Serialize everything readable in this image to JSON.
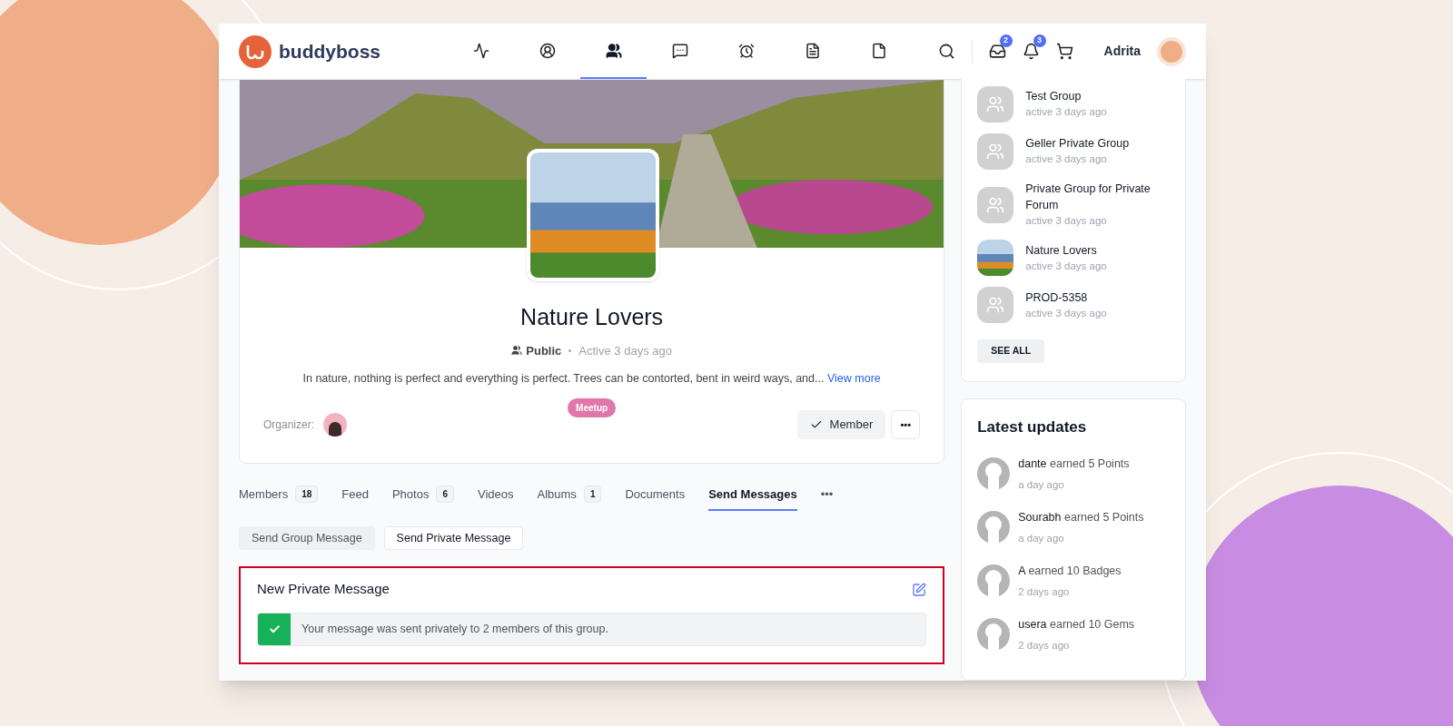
{
  "header": {
    "logo": "buddyboss",
    "nav": [
      {
        "selected": false
      },
      {
        "selected": false
      },
      {
        "selected": true
      },
      {
        "selected": false
      },
      {
        "selected": false
      },
      {
        "selected": false
      },
      {
        "selected": false
      }
    ],
    "inbox_count": "2",
    "notification_count": "3",
    "user": "Adrita"
  },
  "group": {
    "name": "Nature Lovers",
    "privacy": "Public",
    "activity": "Active 3 days ago",
    "description": "In nature, nothing is perfect and everything is perfect. Trees can be contorted, bent in weird ways, and...",
    "more_link": "View more",
    "tag": "Meetup",
    "organizer_label": "Organizer:",
    "member_button": "Member",
    "more_button": "•••"
  },
  "tabs": [
    {
      "label": "Members",
      "count": "18",
      "selected": false
    },
    {
      "label": "Feed",
      "selected": false
    },
    {
      "label": "Photos",
      "count": "6",
      "selected": false
    },
    {
      "label": "Videos",
      "selected": false
    },
    {
      "label": "Albums",
      "count": "1",
      "selected": false
    },
    {
      "label": "Documents",
      "selected": false
    },
    {
      "label": "Send Messages",
      "selected": true
    },
    {
      "label": "•••",
      "selected": false
    }
  ],
  "subtabs": [
    {
      "label": "Send Group Message",
      "selected": false
    },
    {
      "label": "Send Private Message",
      "selected": true
    }
  ],
  "message_panel": {
    "title": "New Private Message",
    "notice": "Your message was sent privately to 2 members of this group."
  },
  "groups_widget": {
    "items": [
      {
        "name": "Test Group",
        "time": "active 3 days ago",
        "kind": "default"
      },
      {
        "name": "Geller Private Group",
        "time": "active 3 days ago",
        "kind": "default"
      },
      {
        "name": "Private Group for Private Forum",
        "time": "active 3 days ago",
        "kind": "default"
      },
      {
        "name": "Nature Lovers",
        "time": "active 3 days ago",
        "kind": "photo"
      },
      {
        "name": "PROD-5358",
        "time": "active 3 days ago",
        "kind": "default"
      }
    ],
    "see_all": "SEE ALL"
  },
  "updates_widget": {
    "title": "Latest updates",
    "items": [
      {
        "actor": "dante",
        "action": "earned 5 Points",
        "time": "a day ago"
      },
      {
        "actor": "Sourabh",
        "action": "earned 5 Points",
        "time": "a day ago"
      },
      {
        "actor": "A",
        "action": "earned 10 Badges",
        "time": "2 days ago"
      },
      {
        "actor": "usera",
        "action": "earned 10 Gems",
        "time": "2 days ago"
      }
    ]
  }
}
